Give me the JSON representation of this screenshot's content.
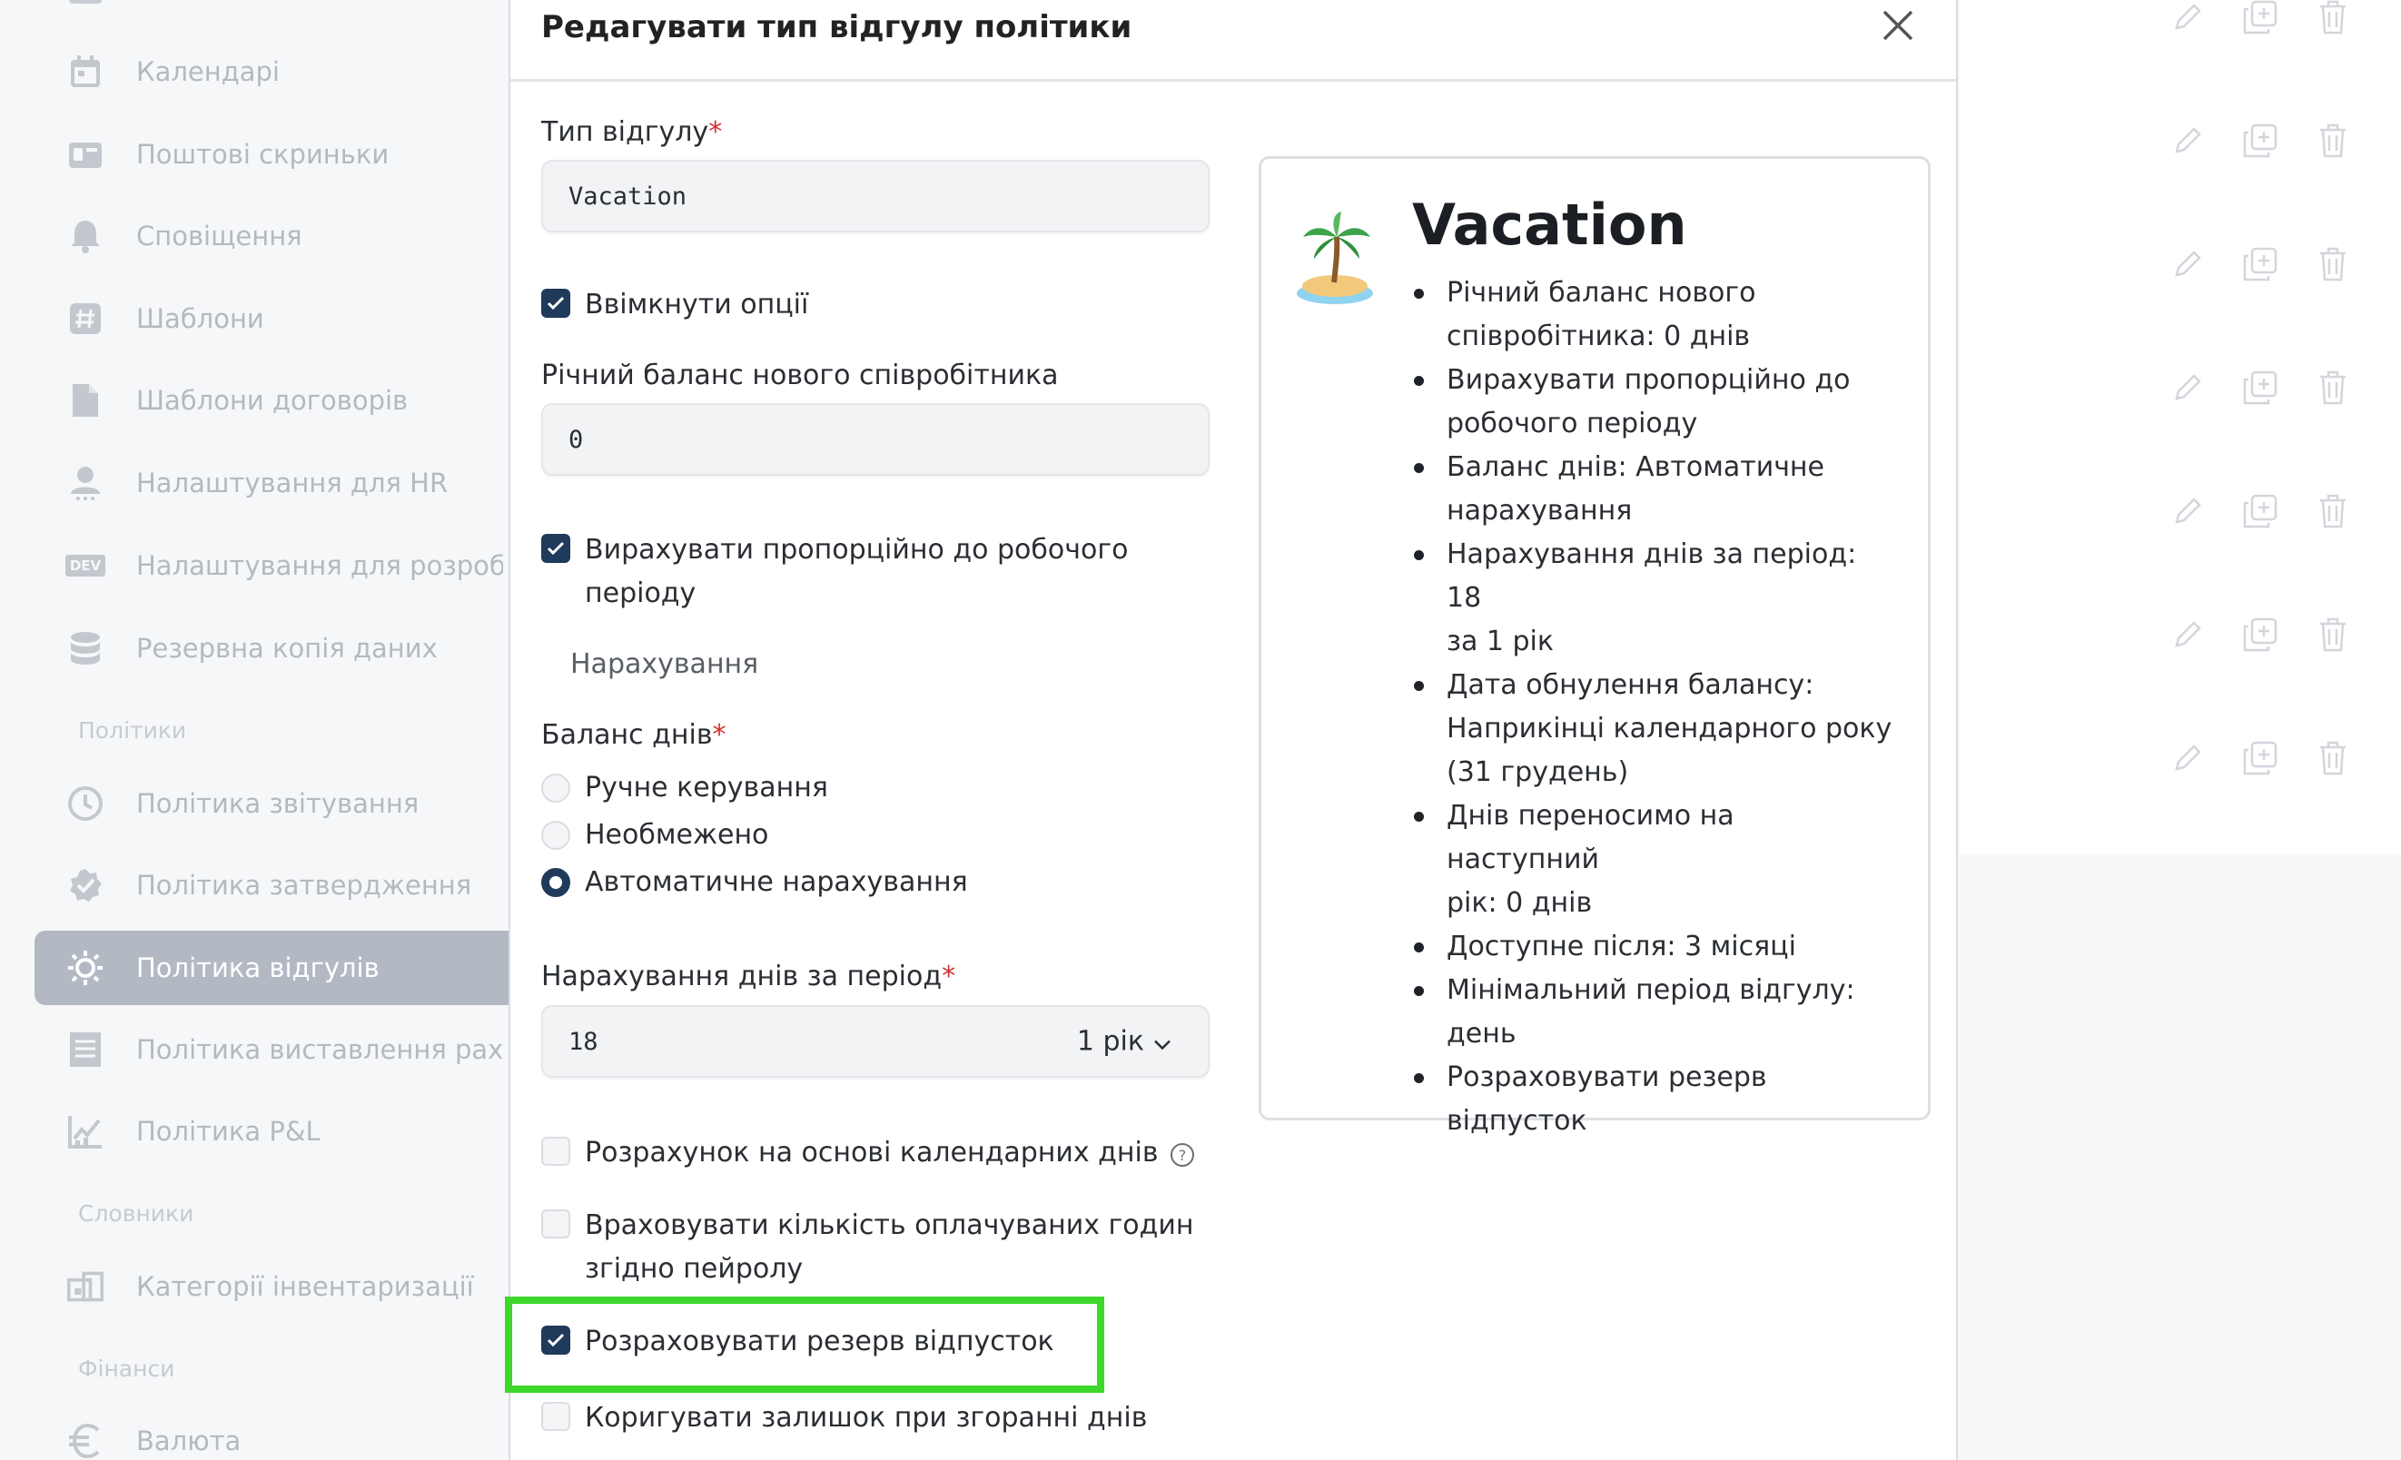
{
  "sidebar": {
    "items": [
      {
        "label": "Календарі",
        "icon": "calendar-icon"
      },
      {
        "label": "Поштові скриньки",
        "icon": "mailbox-icon"
      },
      {
        "label": "Сповіщення",
        "icon": "bell-icon"
      },
      {
        "label": "Шаблони",
        "icon": "hash-icon"
      },
      {
        "label": "Шаблони договорів",
        "icon": "document-icon"
      },
      {
        "label": "Налаштування для HR",
        "icon": "person-icon"
      },
      {
        "label": "Налаштування для розробників",
        "icon": "dev-icon",
        "icon_text": "DEV"
      },
      {
        "label": "Резервна копія даних",
        "icon": "database-icon"
      }
    ],
    "section_policies": "Політики",
    "policy_items": [
      {
        "label": "Політика звітування",
        "icon": "clock-icon"
      },
      {
        "label": "Політика затвердження",
        "icon": "badge-check-icon"
      },
      {
        "label": "Політика відгулів",
        "icon": "sun-icon",
        "active": true
      },
      {
        "label": "Політика виставлення рахунків",
        "icon": "invoice-icon"
      },
      {
        "label": "Політика P&L",
        "icon": "chart-icon"
      }
    ],
    "section_dictionaries": "Словники",
    "dictionary_items": [
      {
        "label": "Категорії інвентаризації",
        "icon": "inventory-icon"
      }
    ],
    "section_finance": "Фінанси",
    "finance_items": [
      {
        "label": "Валюта",
        "icon": "euro-icon"
      }
    ]
  },
  "modal": {
    "title": "Редагувати тип відгулу політики",
    "type_label": "Тип відгулу",
    "type_value": "Vacation",
    "enable_options_label": "Ввімкнути опції",
    "enable_options_checked": true,
    "annual_balance_label": "Річний баланс нового співробітника",
    "annual_balance_value": "0",
    "prorate_label_line1": "Вирахувати пропорційно до робочого",
    "prorate_label_line2": "періоду",
    "prorate_checked": true,
    "accrual_caption": "Нарахування",
    "balance_label": "Баланс днів",
    "balance_options": [
      "Ручне керування",
      "Необмежено",
      "Автоматичне нарахування"
    ],
    "balance_selected": "Автоматичне нарахування",
    "accrual_period_label": "Нарахування днів за період",
    "accrual_period_value": "18",
    "accrual_period_unit": "1 рік",
    "calendar_days_label": "Розрахунок на основі календарних днів",
    "calendar_days_checked": false,
    "paid_hours_label_line1": "Враховувати кількість оплачуваних годин",
    "paid_hours_label_line2": "згідно пейролу",
    "paid_hours_checked": false,
    "reserve_label": "Розраховувати резерв відпусток",
    "reserve_checked": true,
    "adjust_label": "Коригувати залишок при згоранні днів",
    "adjust_checked": false
  },
  "preview": {
    "icon": "palm-island-icon",
    "title": "Vacation",
    "lines": [
      [
        "Річний баланс нового",
        "співробітника: 0 днів"
      ],
      [
        "Вирахувати пропорційно до",
        "робочого періоду"
      ],
      [
        "Баланс днів: Автоматичне",
        "нарахування"
      ],
      [
        "Нарахування днів за період: 18",
        "за 1 рік"
      ],
      [
        "Дата обнулення балансу:",
        "Наприкінці календарного року",
        "(31 грудень)"
      ],
      [
        "Днів переносимо на наступний",
        "рік: 0 днів"
      ],
      [
        "Доступне після: 3 місяці"
      ],
      [
        "Мінімальний період відгулу:",
        "день"
      ],
      [
        "Розраховувати резерв",
        "відпусток"
      ]
    ]
  },
  "list_actions": [
    "edit-icon",
    "duplicate-icon",
    "delete-icon"
  ],
  "colors": {
    "accent": "#1f3a5a",
    "highlight": "#3ed72c",
    "required": "#d32f2f",
    "sidebar_active": "#b3b9c3"
  }
}
